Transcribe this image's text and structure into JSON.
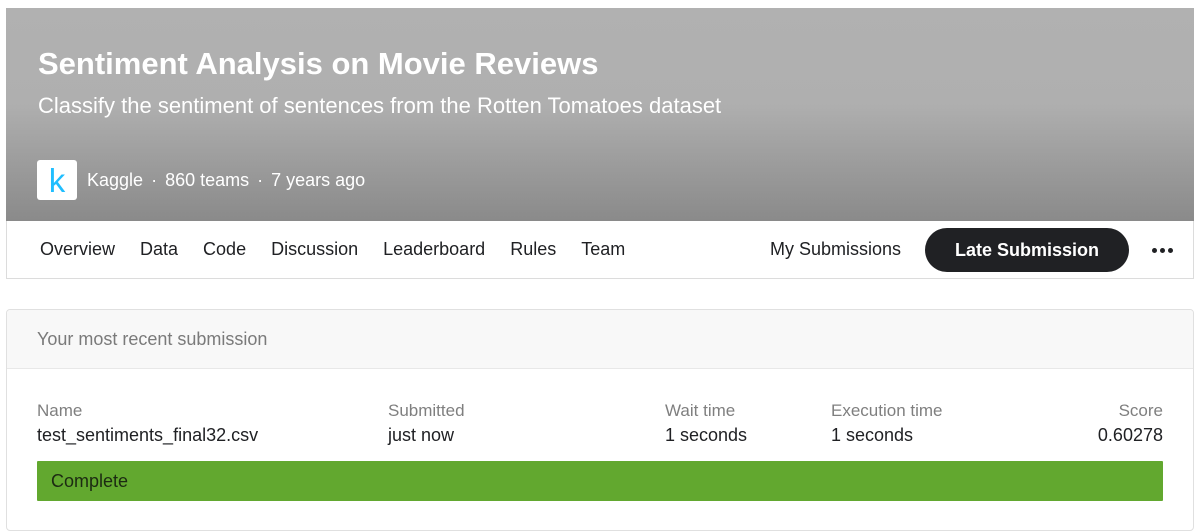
{
  "competition": {
    "title": "Sentiment Analysis on Movie Reviews",
    "subtitle": "Classify the sentiment of sentences from the Rotten Tomatoes dataset",
    "logo_letter": "k",
    "host": "Kaggle",
    "teams": "860 teams",
    "age": "7 years ago",
    "separator": "·",
    "accent_color": "#20beff"
  },
  "nav": {
    "tabs": [
      "Overview",
      "Data",
      "Code",
      "Discussion",
      "Leaderboard",
      "Rules",
      "Team"
    ],
    "my_submissions": "My Submissions",
    "late_submission": "Late Submission",
    "more_icon": "more-horizontal-icon"
  },
  "submission": {
    "header": "Your most recent submission",
    "columns": {
      "name_label": "Name",
      "submitted_label": "Submitted",
      "wait_label": "Wait time",
      "exec_label": "Execution time",
      "score_label": "Score"
    },
    "values": {
      "name": "test_sentiments_final32.csv",
      "submitted": "just now",
      "wait": "1 seconds",
      "exec": "1 seconds",
      "score": "0.60278"
    },
    "status": "Complete",
    "status_color": "#62a82f"
  }
}
